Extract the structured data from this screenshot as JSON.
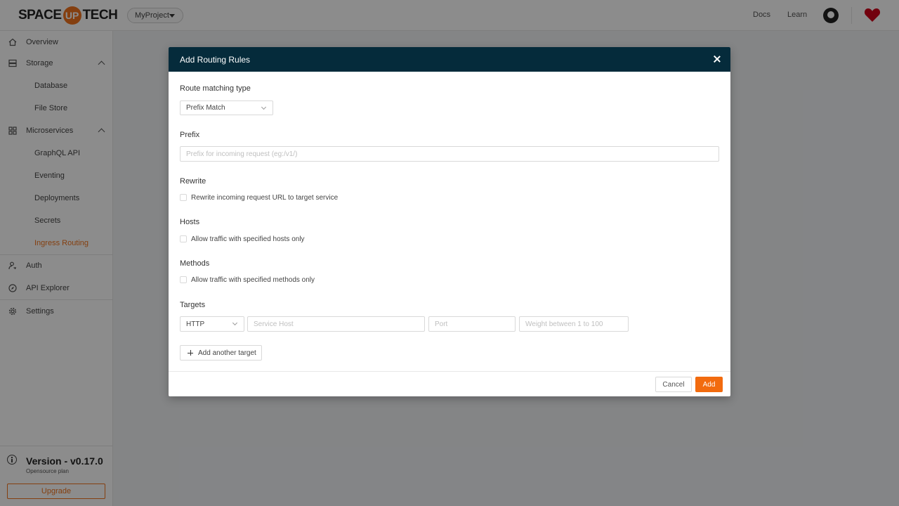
{
  "header": {
    "logo_left": "SPACE",
    "logo_mid": "UP",
    "logo_right": "TECH",
    "project": "MyProject",
    "links": [
      "Docs",
      "Learn"
    ]
  },
  "sidebar": {
    "items": [
      {
        "label": "Overview",
        "icon": "home-icon"
      },
      {
        "label": "Storage",
        "icon": "storage-icon"
      },
      {
        "label": "Database"
      },
      {
        "label": "File Store"
      },
      {
        "label": "Microservices",
        "icon": "microservices-icon"
      },
      {
        "label": "GraphQL API"
      },
      {
        "label": "Eventing"
      },
      {
        "label": "Deployments"
      },
      {
        "label": "Secrets"
      },
      {
        "label": "Ingress Routing",
        "active": true
      },
      {
        "label": "Auth",
        "icon": "user-key-icon"
      },
      {
        "label": "API Explorer",
        "icon": "compass-icon"
      },
      {
        "label": "Settings",
        "icon": "gear-icon"
      }
    ],
    "version": "Version - v0.17.0",
    "plan": "Opensource plan",
    "upgrade": "Upgrade"
  },
  "modal": {
    "title": "Add Routing Rules",
    "route_matching_label": "Route matching type",
    "route_matching_value": "Prefix Match",
    "prefix_label": "Prefix",
    "prefix_placeholder": "Prefix for incoming request (eg:/v1/)",
    "rewrite_label": "Rewrite",
    "rewrite_checkbox": "Rewrite incoming request URL to target service",
    "hosts_label": "Hosts",
    "hosts_checkbox": "Allow traffic with specified hosts only",
    "methods_label": "Methods",
    "methods_checkbox": "Allow traffic with specified methods only",
    "targets_label": "Targets",
    "target_scheme": "HTTP",
    "service_host_placeholder": "Service Host",
    "port_placeholder": "Port",
    "weight_placeholder": "Weight between 1 to 100",
    "add_target": "Add another target",
    "cancel": "Cancel",
    "add": "Add"
  },
  "colors": {
    "accent": "#f0741e",
    "modal_header": "#052b3b",
    "add_button": "#f26b0f"
  }
}
